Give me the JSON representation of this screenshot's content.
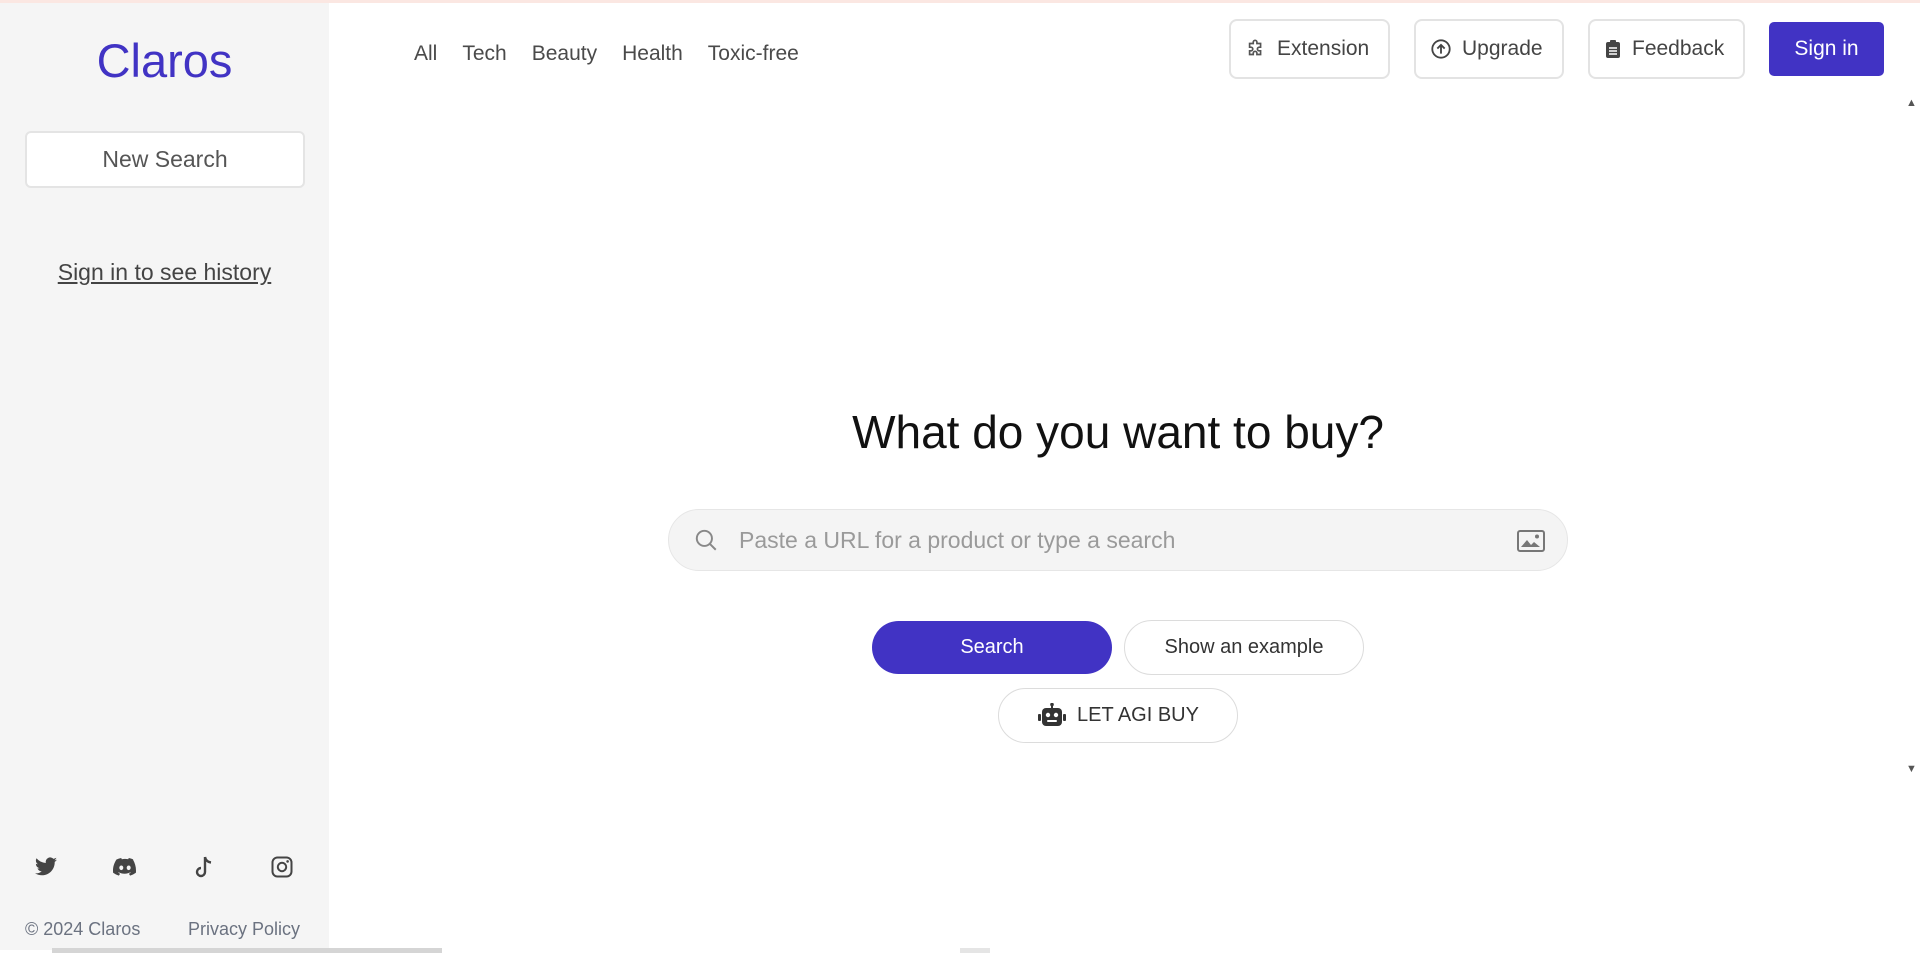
{
  "brand": {
    "name": "Claros",
    "accent": "#4133c4"
  },
  "sidebar": {
    "new_search_label": "New Search",
    "history_link": "Sign in to see history",
    "socials": [
      {
        "name": "twitter-icon"
      },
      {
        "name": "discord-icon"
      },
      {
        "name": "tiktok-icon"
      },
      {
        "name": "instagram-icon"
      }
    ],
    "footer": {
      "copyright": "© 2024 Claros",
      "privacy": "Privacy Policy"
    }
  },
  "nav": {
    "items": [
      "All",
      "Tech",
      "Beauty",
      "Health",
      "Toxic-free"
    ]
  },
  "header": {
    "extension_label": "Extension",
    "upgrade_label": "Upgrade",
    "feedback_label": "Feedback",
    "signin_label": "Sign in"
  },
  "main": {
    "title": "What do you want to buy?",
    "search_placeholder": "Paste a URL for a product or type a search",
    "search_value": "",
    "search_button": "Search",
    "example_button": "Show an example",
    "agi_button": "LET AGI BUY"
  }
}
